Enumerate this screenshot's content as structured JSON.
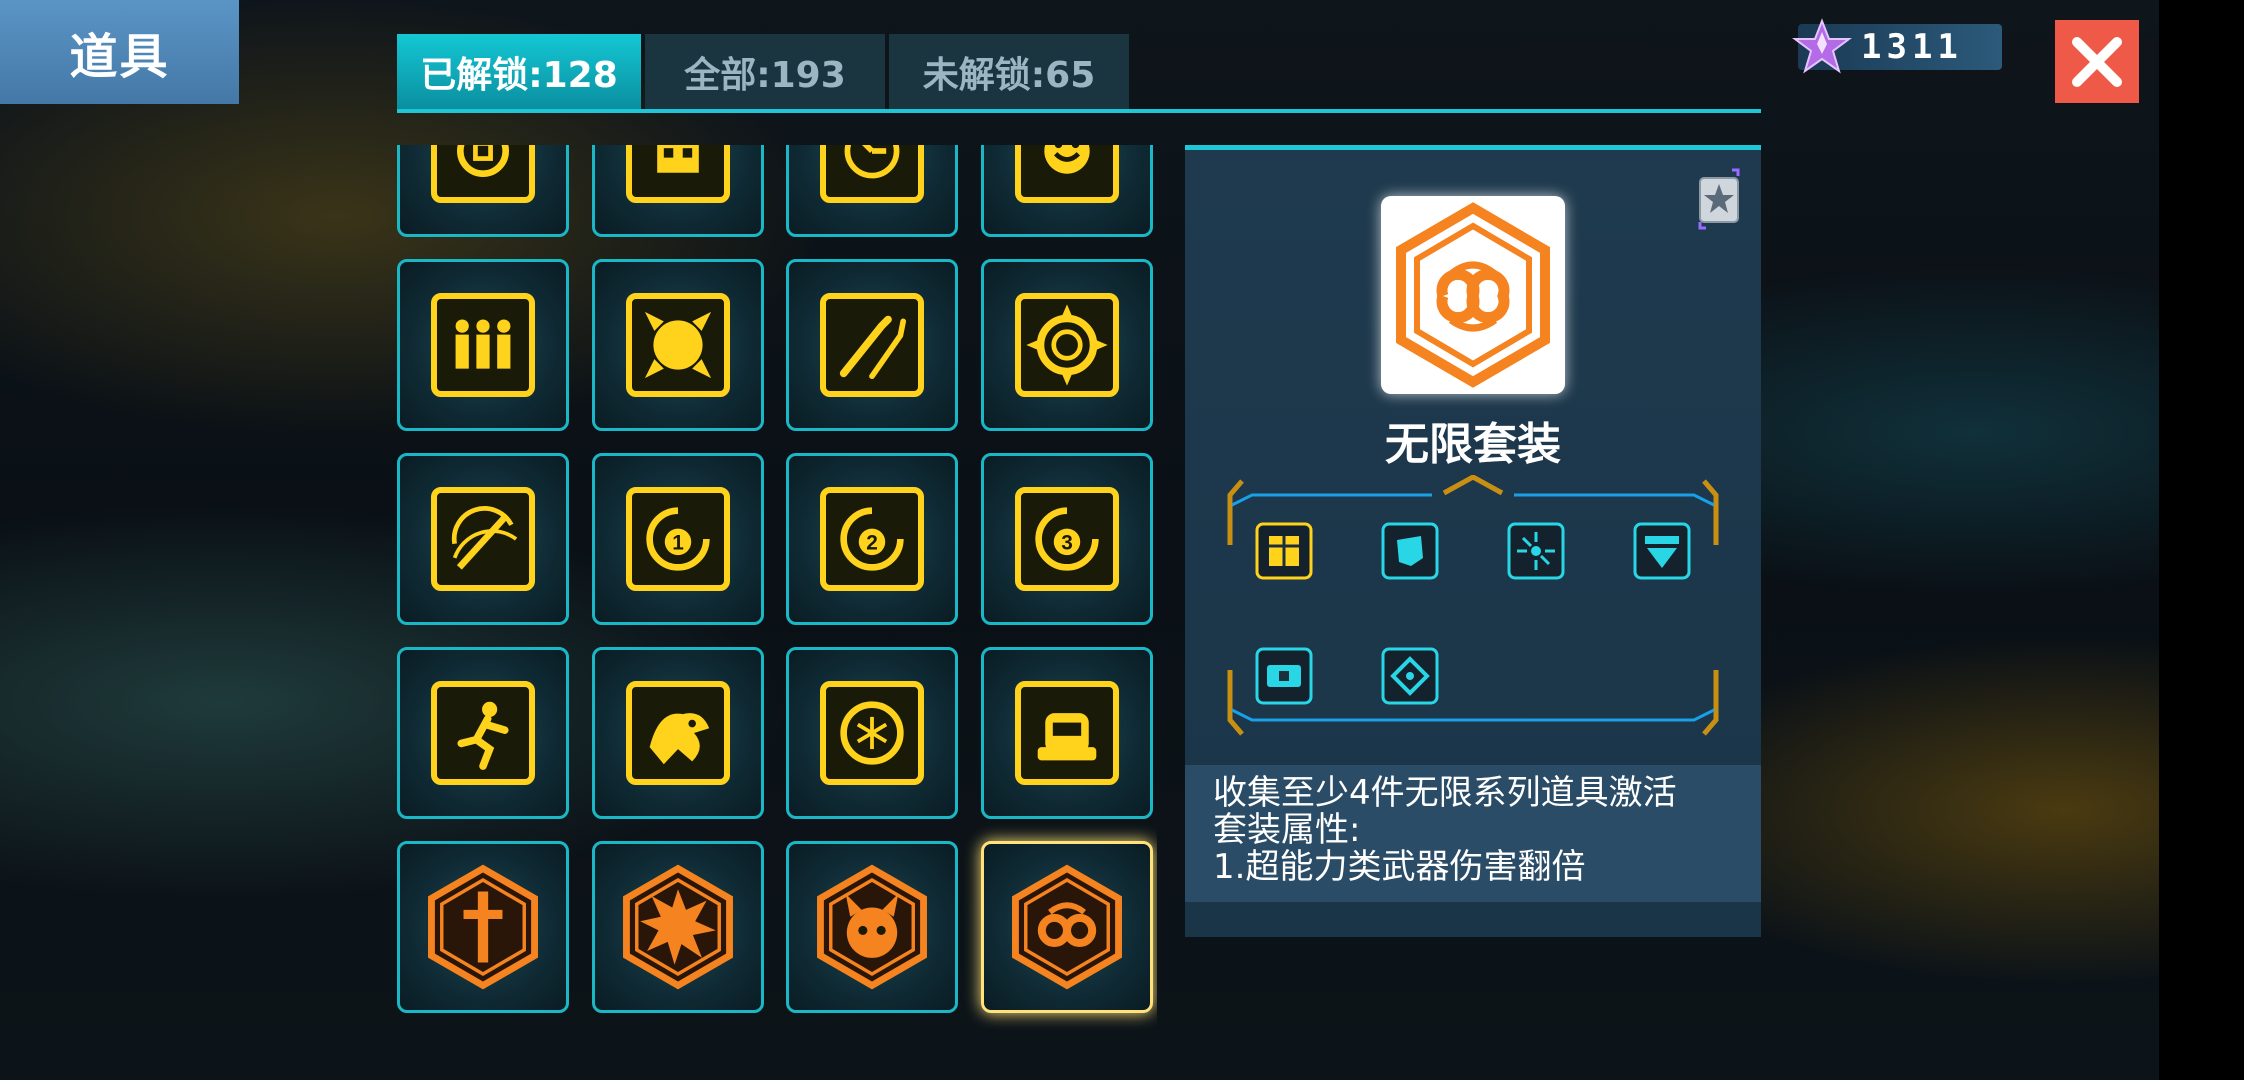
{
  "header": {
    "title": "道具",
    "tabs": [
      {
        "label": "已解锁:128",
        "active": true
      },
      {
        "label": "全部:193",
        "active": false
      },
      {
        "label": "未解锁:65",
        "active": false
      }
    ],
    "currency": {
      "value": "1311",
      "icon": "purple-star-gem-icon"
    },
    "close_icon": "close-icon"
  },
  "grid": {
    "items": [
      {
        "icon": "clock-item-icon",
        "color": "yellow"
      },
      {
        "icon": "robot-item-icon",
        "color": "yellow"
      },
      {
        "icon": "timer-item-icon",
        "color": "yellow"
      },
      {
        "icon": "smiling-sun-item-icon",
        "color": "yellow"
      },
      {
        "icon": "three-people-item-icon",
        "color": "yellow"
      },
      {
        "icon": "sun-burst-item-icon",
        "color": "yellow"
      },
      {
        "icon": "claw-slash-item-icon",
        "color": "yellow"
      },
      {
        "icon": "spiked-gear-item-icon",
        "color": "yellow"
      },
      {
        "icon": "sword-swing-item-icon",
        "color": "yellow"
      },
      {
        "icon": "charge-1-item-icon",
        "color": "yellow",
        "number": "1"
      },
      {
        "icon": "charge-2-item-icon",
        "color": "yellow",
        "number": "2"
      },
      {
        "icon": "charge-3-item-icon",
        "color": "yellow",
        "number": "3"
      },
      {
        "icon": "running-man-item-icon",
        "color": "yellow"
      },
      {
        "icon": "dragon-item-icon",
        "color": "yellow"
      },
      {
        "icon": "snowflake-swirl-item-icon",
        "color": "yellow"
      },
      {
        "icon": "robot-head-item-icon",
        "color": "yellow"
      },
      {
        "icon": "sword-hexagon-item-icon",
        "color": "orange"
      },
      {
        "icon": "fist-burst-hexagon-item-icon",
        "color": "orange"
      },
      {
        "icon": "devil-hexagon-item-icon",
        "color": "orange"
      },
      {
        "icon": "infinity-hexagon-item-icon",
        "color": "orange",
        "selected": true
      }
    ]
  },
  "detail": {
    "name": "无限套装",
    "image_icon": "infinity-hexagon-item-icon",
    "badge_icon": "star-badge-icon",
    "set_items": [
      {
        "icon": "chest-armor-icon",
        "color": "#ffd21c"
      },
      {
        "icon": "glove-icon",
        "color": "#29d6e6"
      },
      {
        "icon": "circuit-icon",
        "color": "#29d6e6"
      },
      {
        "icon": "heart-shield-icon",
        "color": "#29d6e6"
      },
      {
        "icon": "belt-icon",
        "color": "#29d6e6"
      },
      {
        "icon": "target-diamond-icon",
        "color": "#29d6e6"
      }
    ],
    "description_lines": [
      "收集至少4件无限系列道具激活",
      "套装属性:",
      "1.超能力类武器伤害翻倍"
    ]
  },
  "colors": {
    "accent": "#1ec6d6",
    "item_yellow": "#ffd21c",
    "item_orange": "#f5831f",
    "close_red": "#ef5a48"
  }
}
